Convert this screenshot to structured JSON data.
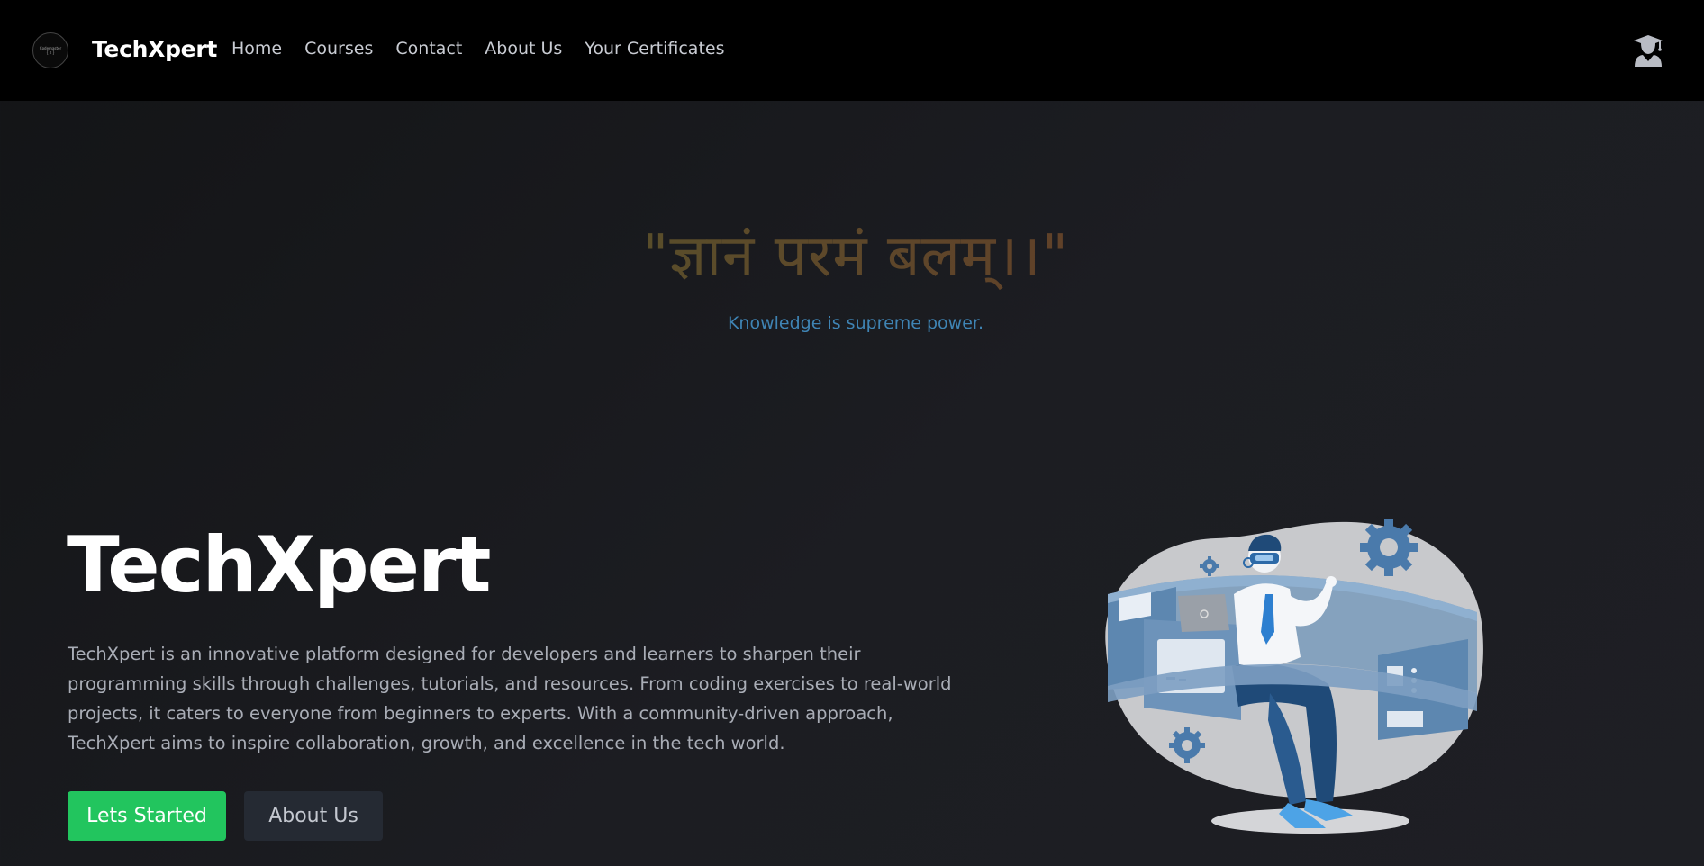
{
  "navbar": {
    "logo_text": [
      "Codemaster",
      "{ x }"
    ],
    "brand": "TechXpert",
    "links": [
      "Home",
      "Courses",
      "Contact",
      "About Us",
      "Your Certificates"
    ],
    "user_icon": "user-graduate-icon"
  },
  "hero": {
    "quote": "\"ज्ञानं परमं बलम्।।\"",
    "quote_translation": "Knowledge is supreme power.",
    "title": "TechXpert",
    "description": "TechXpert is an innovative platform designed for developers and learners to sharpen their programming skills through challenges, tutorials, and resources. From coding exercises to real-world projects, it caters to everyone from beginners to experts. With a community-driven approach, TechXpert aims to inspire collaboration, growth, and excellence in the tech world.",
    "primary_button": "Lets Started",
    "secondary_button": "About Us",
    "illustration": "developer-vr-illustration"
  },
  "colors": {
    "navbar_bg": "#000000",
    "accent_green": "#22c55e",
    "translation_blue": "#3f84b4",
    "secondary_button_bg": "#252a33"
  }
}
